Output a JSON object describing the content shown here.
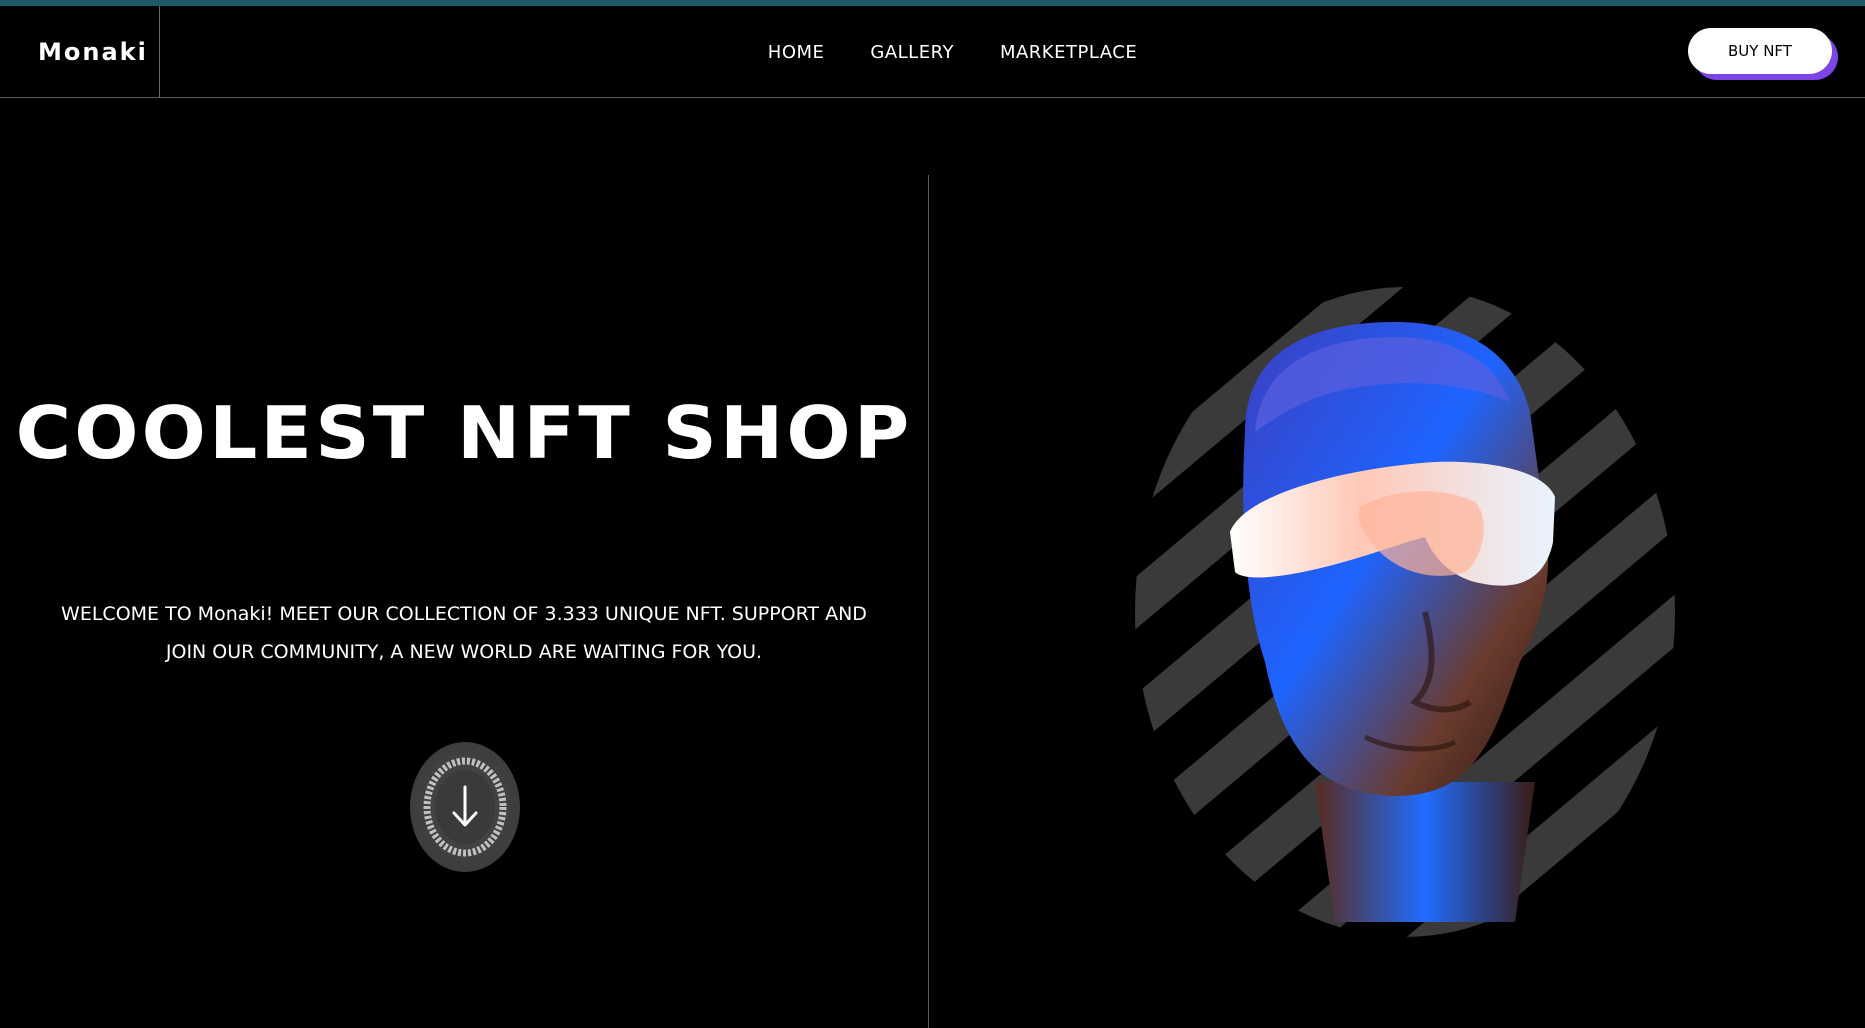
{
  "header": {
    "logo": "Monaki",
    "nav": [
      "HOME",
      "GALLERY",
      "MARKETPLACE"
    ],
    "buy_button": "BUY NFT"
  },
  "hero": {
    "title": "COOLEST NFT SHOP",
    "subtitle_line1": "WELCOME TO Monaki! MEET OUR COLLECTION OF 3.333 UNIQUE NFT. SUPPORT AND",
    "subtitle_line2": "JOIN OUR COMMUNITY, A NEW WORLD ARE WAITING FOR YOU.",
    "scroll_icon": "arrow-down-icon"
  },
  "colors": {
    "background": "#000000",
    "accent": "#7b45e8",
    "top_strip": "#1d5a66",
    "divider": "#5a5a5a"
  }
}
